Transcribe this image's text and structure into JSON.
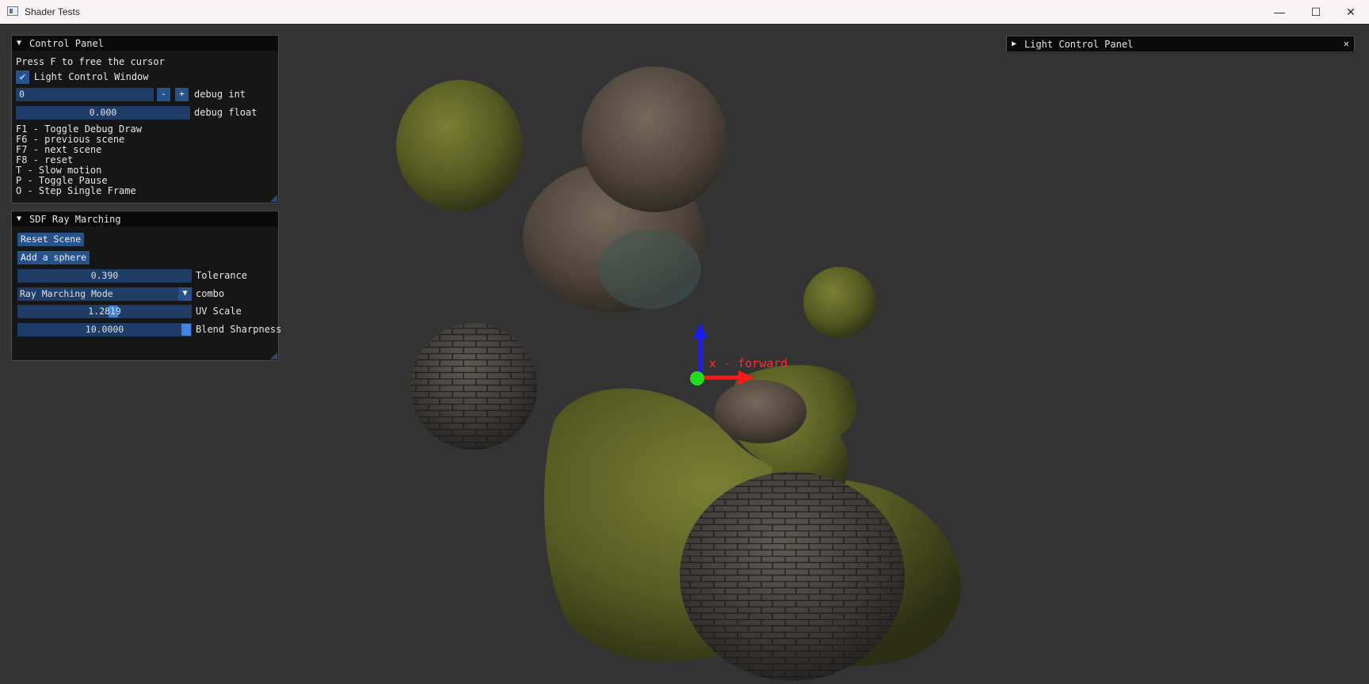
{
  "window": {
    "title": "Shader Tests",
    "minimize_label": "—",
    "maximize_label": "☐",
    "close_label": "✕"
  },
  "control_panel": {
    "title": "Control Panel",
    "collapse_arrow": "▼",
    "hint": "Press F to free the cursor",
    "checkbox_label": "Light Control Window",
    "checkbox_checked": true,
    "debug_int_value": "0",
    "debug_int_label": "debug int",
    "minus_label": "-",
    "plus_label": "+",
    "debug_float_value": "0.000",
    "debug_float_label": "debug float",
    "shortcuts": [
      "F1 - Toggle Debug Draw",
      "F6 - previous scene",
      "F7 - next scene",
      "F8 - reset",
      "T - Slow motion",
      "P - Toggle Pause",
      "O - Step Single Frame"
    ]
  },
  "sdf_panel": {
    "title": "SDF Ray Marching",
    "collapse_arrow": "▼",
    "reset_button": "Reset Scene",
    "add_sphere_button": "Add a sphere",
    "tolerance_value": "0.390",
    "tolerance_label": "Tolerance",
    "combo_value": "Ray Marching Mode",
    "combo_label": "combo",
    "uv_scale_value": "1.2819",
    "uv_scale_label": "UV Scale",
    "blend_value": "10.0000",
    "blend_label": "Blend Sharpness"
  },
  "light_panel": {
    "title": "Light Control Panel",
    "expand_arrow": "▶",
    "close_label": "✕"
  },
  "gizmo": {
    "label": "x - forward"
  },
  "colors": {
    "moss": "#5c6226",
    "rock": "#5a4e42",
    "brick": "#3d3a36",
    "panel_bg": "#141414",
    "accent": "#27538c"
  }
}
